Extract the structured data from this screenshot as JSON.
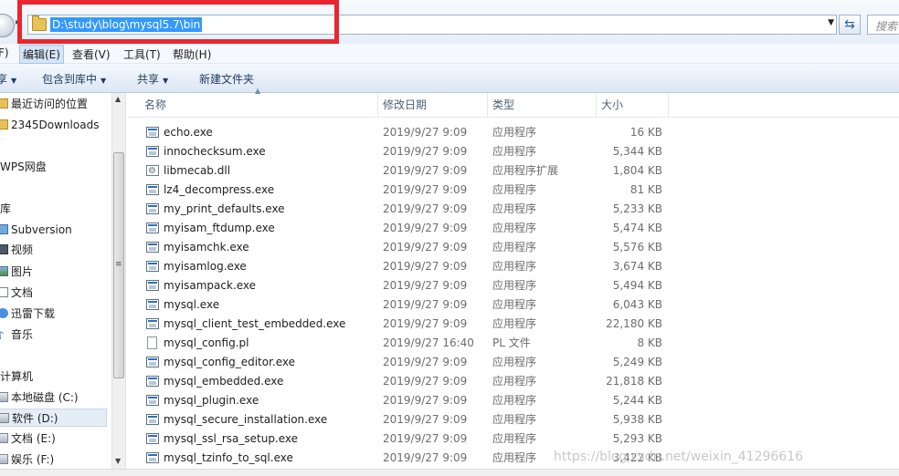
{
  "address_bar": {
    "path": "D:\\study\\blog\\mysql5.7\\bin",
    "search_placeholder": "搜索"
  },
  "menu": {
    "items": [
      "F)",
      "编辑(E)",
      "查看(V)",
      "工具(T)",
      "帮助(H)"
    ],
    "active_index": 1
  },
  "toolbar": {
    "items": [
      "享",
      "包含到库中",
      "共享",
      "新建文件夹"
    ]
  },
  "nav_pane": {
    "items": [
      {
        "label": "最近访问的位置",
        "icon": "recent-icon"
      },
      {
        "label": "2345Downloads",
        "icon": "folder-icon"
      },
      {
        "label": "WPS网盘",
        "icon": "cloud-icon"
      },
      {
        "label": "库",
        "icon": "library-icon"
      },
      {
        "label": "Subversion",
        "icon": "svn-icon"
      },
      {
        "label": "视频",
        "icon": "video-icon"
      },
      {
        "label": "图片",
        "icon": "picture-icon"
      },
      {
        "label": "文档",
        "icon": "document-icon"
      },
      {
        "label": "迅雷下载",
        "icon": "thunder-icon"
      },
      {
        "label": "音乐",
        "icon": "music-icon"
      },
      {
        "label": "计算机",
        "icon": "computer-icon"
      },
      {
        "label": "本地磁盘 (C:)",
        "icon": "drive-icon"
      },
      {
        "label": "软件 (D:)",
        "icon": "drive-icon",
        "selected": true
      },
      {
        "label": "文档 (E:)",
        "icon": "drive-icon"
      },
      {
        "label": "娱乐 (F:)",
        "icon": "drive-icon"
      }
    ]
  },
  "columns": {
    "name": "名称",
    "date": "修改日期",
    "type": "类型",
    "size": "大小"
  },
  "files": [
    {
      "name": "echo.exe",
      "date": "2019/9/27 9:09",
      "type": "应用程序",
      "size": "16 KB",
      "kind": "exe"
    },
    {
      "name": "innochecksum.exe",
      "date": "2019/9/27 9:09",
      "type": "应用程序",
      "size": "5,344 KB",
      "kind": "exe"
    },
    {
      "name": "libmecab.dll",
      "date": "2019/9/27 9:09",
      "type": "应用程序扩展",
      "size": "1,804 KB",
      "kind": "dll"
    },
    {
      "name": "lz4_decompress.exe",
      "date": "2019/9/27 9:09",
      "type": "应用程序",
      "size": "81 KB",
      "kind": "exe"
    },
    {
      "name": "my_print_defaults.exe",
      "date": "2019/9/27 9:09",
      "type": "应用程序",
      "size": "5,233 KB",
      "kind": "exe"
    },
    {
      "name": "myisam_ftdump.exe",
      "date": "2019/9/27 9:09",
      "type": "应用程序",
      "size": "5,474 KB",
      "kind": "exe"
    },
    {
      "name": "myisamchk.exe",
      "date": "2019/9/27 9:09",
      "type": "应用程序",
      "size": "5,576 KB",
      "kind": "exe"
    },
    {
      "name": "myisamlog.exe",
      "date": "2019/9/27 9:09",
      "type": "应用程序",
      "size": "3,674 KB",
      "kind": "exe"
    },
    {
      "name": "myisampack.exe",
      "date": "2019/9/27 9:09",
      "type": "应用程序",
      "size": "5,494 KB",
      "kind": "exe"
    },
    {
      "name": "mysql.exe",
      "date": "2019/9/27 9:09",
      "type": "应用程序",
      "size": "6,043 KB",
      "kind": "exe"
    },
    {
      "name": "mysql_client_test_embedded.exe",
      "date": "2019/9/27 9:09",
      "type": "应用程序",
      "size": "22,180 KB",
      "kind": "exe"
    },
    {
      "name": "mysql_config.pl",
      "date": "2019/9/27 16:40",
      "type": "PL 文件",
      "size": "8 KB",
      "kind": "txt"
    },
    {
      "name": "mysql_config_editor.exe",
      "date": "2019/9/27 9:09",
      "type": "应用程序",
      "size": "5,249 KB",
      "kind": "exe"
    },
    {
      "name": "mysql_embedded.exe",
      "date": "2019/9/27 9:09",
      "type": "应用程序",
      "size": "21,818 KB",
      "kind": "exe"
    },
    {
      "name": "mysql_plugin.exe",
      "date": "2019/9/27 9:09",
      "type": "应用程序",
      "size": "5,244 KB",
      "kind": "exe"
    },
    {
      "name": "mysql_secure_installation.exe",
      "date": "2019/9/27 9:09",
      "type": "应用程序",
      "size": "5,938 KB",
      "kind": "exe"
    },
    {
      "name": "mysql_ssl_rsa_setup.exe",
      "date": "2019/9/27 9:09",
      "type": "应用程序",
      "size": "5,293 KB",
      "kind": "exe"
    },
    {
      "name": "mysql_tzinfo_to_sql.exe",
      "date": "2019/9/27 9:09",
      "type": "应用程序",
      "size": "3,422 KB",
      "kind": "exe"
    }
  ],
  "watermark": "https://blog.csdn.net/weixin_41296616",
  "colors": {
    "selection": "#3399ff",
    "annotation_box": "#e8262f",
    "toolbar_text": "#1e395b"
  }
}
